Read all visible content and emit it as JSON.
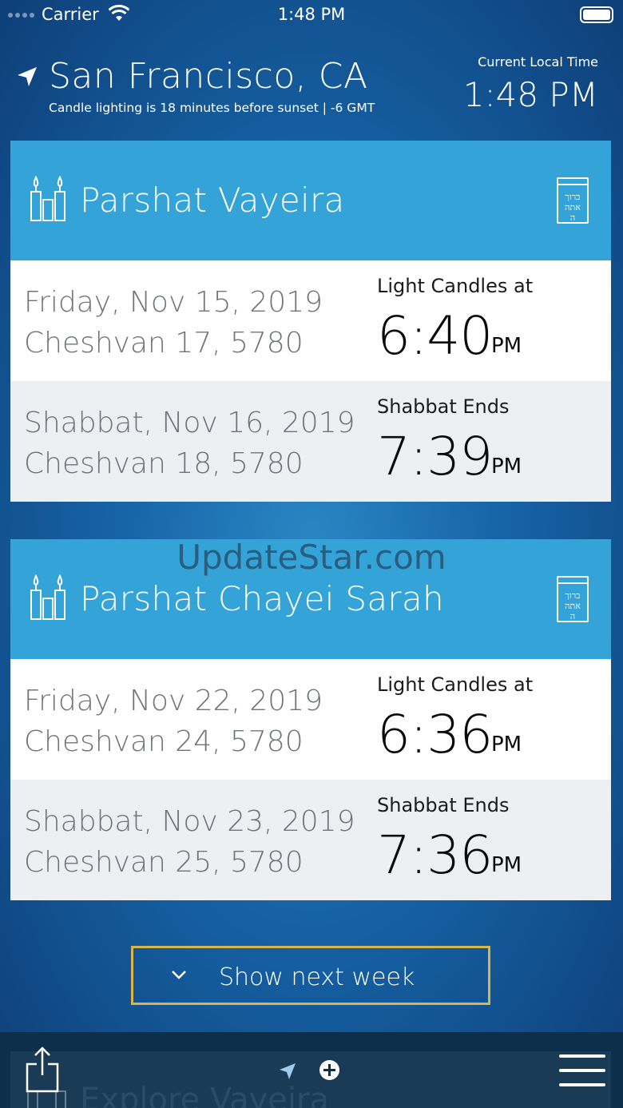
{
  "status_bar": {
    "carrier": "Carrier",
    "time": "1:48 PM"
  },
  "header": {
    "city": "San Francisco, CA",
    "subtitle": "Candle lighting is 18 minutes before sunset | -6 GMT",
    "local_time_label": "Current Local Time",
    "local_time": "1:48 PM"
  },
  "weeks": [
    {
      "parsha": "Parshat Vayeira",
      "friday": {
        "date": "Friday, Nov 15, 2019",
        "hebrew": "Cheshvan 17, 5780",
        "label": "Light Candles at",
        "time": "6:40",
        "ampm": "PM"
      },
      "shabbat": {
        "date": "Shabbat, Nov 16, 2019",
        "hebrew": "Cheshvan 18, 5780",
        "label": "Shabbat Ends",
        "time": "7:39",
        "ampm": "PM"
      }
    },
    {
      "parsha": "Parshat Chayei Sarah",
      "friday": {
        "date": "Friday, Nov 22, 2019",
        "hebrew": "Cheshvan 24, 5780",
        "label": "Light Candles at",
        "time": "6:36",
        "ampm": "PM"
      },
      "shabbat": {
        "date": "Shabbat, Nov 23, 2019",
        "hebrew": "Cheshvan 25, 5780",
        "label": "Shabbat Ends",
        "time": "7:36",
        "ampm": "PM"
      }
    }
  ],
  "book_icon_text": "ברוך אתה ה",
  "watermark": "UpdateStar.com",
  "show_next_week": "Show next week",
  "bottom_bar": {
    "peek_title": "Explore Vayeira"
  },
  "colors": {
    "card_header": "#34a4d8",
    "button_border": "#d7b54a",
    "bottom_bar": "#0e2f4a"
  },
  "icons": [
    "location-arrow-icon",
    "candles-icon",
    "siddur-book-icon",
    "chevron-down-icon",
    "share-icon",
    "navigation-icon",
    "plus-circle-icon",
    "hamburger-menu-icon"
  ]
}
